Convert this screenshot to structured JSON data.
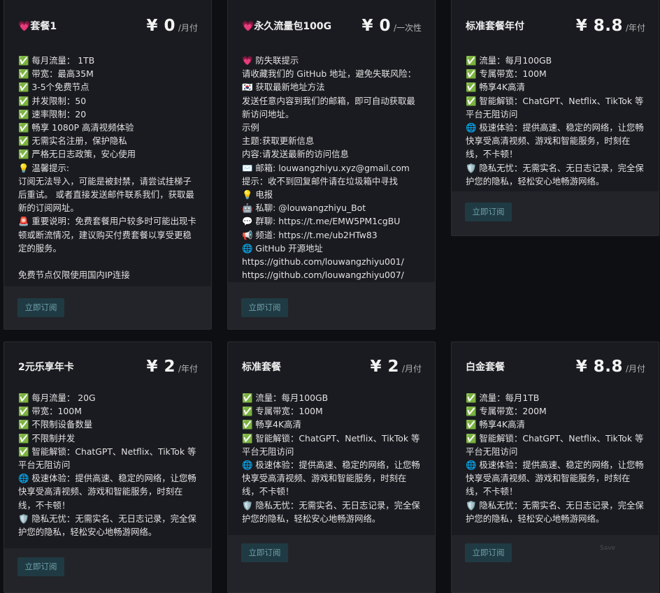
{
  "cards": [
    {
      "name": "💗套餐1",
      "price": "¥ 0",
      "period": "/月付",
      "button": "立即订阅",
      "lines": [
        "✅ 每月流量： 1TB",
        "✅ 带宽：最高35M",
        "✅ 3-5个免费节点",
        "✅ 并发限制：50",
        "✅ 速率限制：20",
        "✅ 畅享 1080P 高清视频体验",
        "✅ 无需实名注册，保护隐私",
        "✅ 严格无日志政策，安心使用",
        "💡 温馨提示:",
        "订阅无法导入，可能是被封禁，请尝试挂梯子后重试。 或者直接发送邮件联系我们，获取最新的订阅网址。",
        "🚨 重要说明：免费套餐用户较多时可能出现卡顿或断流情况，建议购买付费套餐以享受更稳定的服务。",
        "",
        "免费节点仅限使用国内IP连接"
      ]
    },
    {
      "name": "💗永久流量包100G",
      "price": "¥ 0",
      "period": "/一次性",
      "button": "立即订阅",
      "lines": [
        "💗 防失联提示",
        "请收藏我们的 GitHub 地址，避免失联风险：",
        "🇰🇷 获取最新地址方法",
        "发送任意内容到我们的邮箱，即可自动获取最新访问地址。",
        "示例",
        "主题:获取更新信息",
        "内容:请发送最新的访问信息",
        "✉️ 邮箱: louwangzhiyu.xyz@gmail.com",
        "提示：收不到回复邮件请在垃圾箱中寻找",
        "💡 电报",
        "🤖 私聊: @louwangzhiyu_Bot",
        "💬 群聊: https://t.me/EMW5PM1cgBU",
        "📢 频道: https://t.me/ub2HTw83",
        "🌐 GitHub 开源地址",
        "https://github.com/louwangzhiyu001/",
        "https://github.com/louwangzhiyu007/"
      ]
    },
    {
      "name": "标准套餐年付",
      "price": "¥ 8.8",
      "period": "/年付",
      "button": "立即订阅",
      "lines": [
        "✅ 流量：每月100GB",
        "✅ 专属带宽：100M",
        "✅ 畅享4K高清",
        "✅ 智能解锁：ChatGPT、Netflix、TikTok 等平台无阻访问",
        "🌐 极速体验：提供高速、稳定的网络，让您畅快享受高清视频、游戏和智能服务，时刻在线，不卡顿！",
        "🛡️ 隐私无忧：无需实名、无日志记录，完全保护您的隐私，轻松安心地畅游网络。"
      ]
    },
    {
      "name": "2元乐享年卡",
      "price": "¥ 2",
      "period": "/年付",
      "button": "立即订阅",
      "lines": [
        "✅ 每月流量： 20G",
        "✅ 带宽：100M",
        "✅ 不限制设备数量",
        "✅ 不限制并发",
        "✅ 智能解锁：ChatGPT、Netflix、TikTok 等平台无阻访问",
        "🌐 极速体验：提供高速、稳定的网络，让您畅快享受高清视频、游戏和智能服务，时刻在线，不卡顿！",
        "🛡️ 隐私无忧：无需实名、无日志记录，完全保护您的隐私，轻松安心地畅游网络。"
      ]
    },
    {
      "name": "标准套餐",
      "price": "¥ 2",
      "period": "/月付",
      "button": "立即订阅",
      "lines": [
        "✅ 流量：每月100GB",
        "✅ 专属带宽：100M",
        "✅ 畅享4K高清",
        "✅ 智能解锁：ChatGPT、Netflix、TikTok 等平台无阻访问",
        "🌐 极速体验：提供高速、稳定的网络，让您畅快享受高清视频、游戏和智能服务，时刻在线，不卡顿！",
        "🛡️ 隐私无忧：无需实名、无日志记录，完全保护您的隐私，轻松安心地畅游网络。"
      ]
    },
    {
      "name": "白金套餐",
      "price": "¥ 8.8",
      "period": "/月付",
      "button": "立即订阅",
      "lines": [
        "✅ 流量：每月1TB",
        "✅ 专属带宽：200M",
        "✅ 畅享4K高清",
        "✅ 智能解锁：ChatGPT、Netflix、TikTok 等平台无阻访问",
        "🌐 极速体验：提供高速、稳定的网络，让您畅快享受高清视频、游戏和智能服务，时刻在线，不卡顿！",
        "🛡️ 隐私无忧：无需实名、无日志记录，完全保护您的隐私，轻松安心地畅游网络。"
      ]
    }
  ],
  "save_hint": "Save"
}
